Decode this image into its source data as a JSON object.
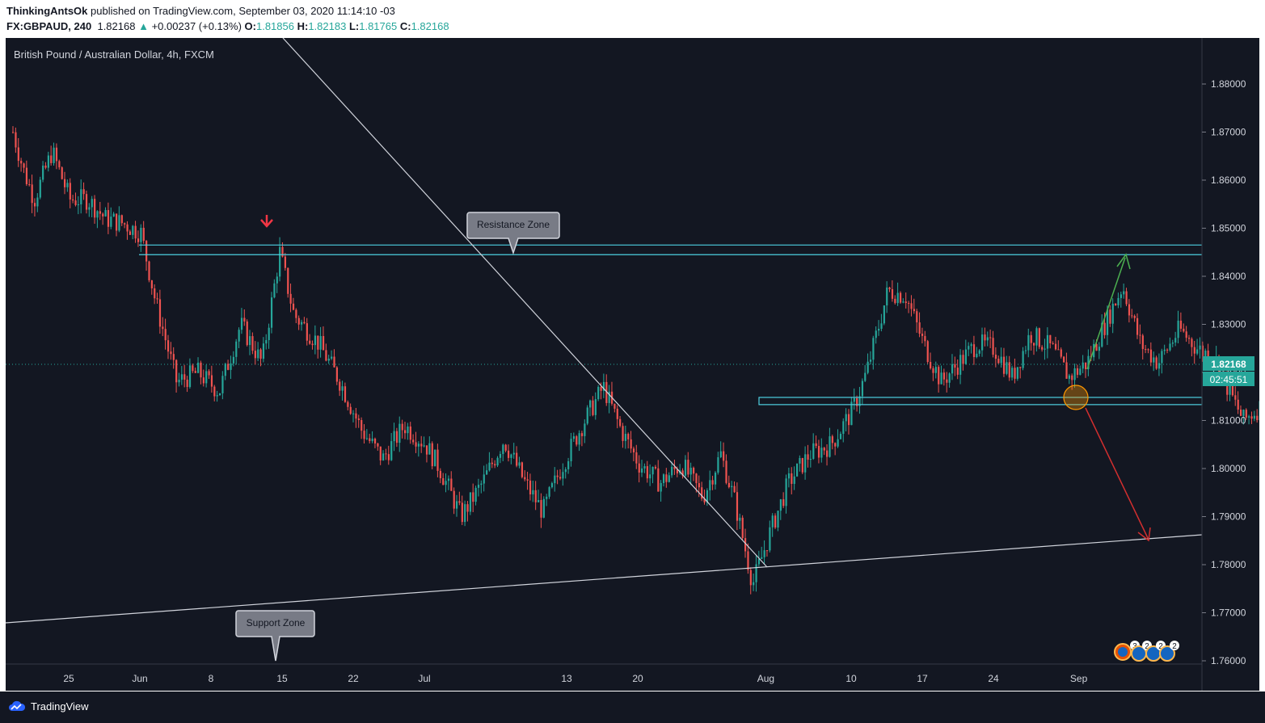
{
  "header": {
    "author": "ThinkingAntsOk",
    "published_text": "published on TradingView.com, September 03, 2020 11:14:10 -03",
    "symbol": "FX:GBPAUD, 240",
    "last": "1.82168",
    "change": "+0.00237 (+0.13%)",
    "open_label": "O:",
    "open": "1.81856",
    "high_label": "H:",
    "high": "1.82183",
    "low_label": "L:",
    "low": "1.81765",
    "close_label": "C:",
    "close": "1.82168"
  },
  "chart_data": {
    "type": "candlestick",
    "title": "British Pound / Australian Dollar, 4h, FXCM",
    "y_ticks": [
      "1.88000",
      "1.87000",
      "1.86000",
      "1.85000",
      "1.84000",
      "1.83000",
      "1.82000",
      "1.81000",
      "1.80000",
      "1.79000",
      "1.78000",
      "1.77000",
      "1.76000"
    ],
    "ylim": [
      1.76,
      1.885
    ],
    "x_ticks": [
      "25",
      "Jun",
      "8",
      "15",
      "22",
      "Jul",
      "13",
      "20",
      "Aug",
      "10",
      "17",
      "24",
      "Sep"
    ],
    "price_path": [
      [
        0,
        1.87
      ],
      [
        0.15,
        1.862
      ],
      [
        0.3,
        1.856
      ],
      [
        0.55,
        1.866
      ],
      [
        0.8,
        1.856
      ],
      [
        1.05,
        1.856
      ],
      [
        1.3,
        1.852
      ],
      [
        1.55,
        1.851
      ],
      [
        1.8,
        1.849
      ],
      [
        2.0,
        1.835
      ],
      [
        2.3,
        1.818
      ],
      [
        2.6,
        1.82
      ],
      [
        2.9,
        1.816
      ],
      [
        3.2,
        1.83
      ],
      [
        3.5,
        1.822
      ],
      [
        3.75,
        1.845
      ],
      [
        3.95,
        1.832
      ],
      [
        4.3,
        1.826
      ],
      [
        4.6,
        1.818
      ],
      [
        4.9,
        1.808
      ],
      [
        5.2,
        1.802
      ],
      [
        5.5,
        1.809
      ],
      [
        5.8,
        1.805
      ],
      [
        6.0,
        1.8
      ],
      [
        6.3,
        1.79
      ],
      [
        6.6,
        1.797
      ],
      [
        6.9,
        1.806
      ],
      [
        7.2,
        1.797
      ],
      [
        7.45,
        1.791
      ],
      [
        7.7,
        1.8
      ],
      [
        8.0,
        1.809
      ],
      [
        8.3,
        1.817
      ],
      [
        8.55,
        1.808
      ],
      [
        8.8,
        1.801
      ],
      [
        9.1,
        1.797
      ],
      [
        9.4,
        1.801
      ],
      [
        9.7,
        1.794
      ],
      [
        9.95,
        1.803
      ],
      [
        10.15,
        1.793
      ],
      [
        10.4,
        1.776
      ],
      [
        10.65,
        1.787
      ],
      [
        10.9,
        1.797
      ],
      [
        11.2,
        1.803
      ],
      [
        11.5,
        1.805
      ],
      [
        11.8,
        1.812
      ],
      [
        12.0,
        1.82
      ],
      [
        12.3,
        1.837
      ],
      [
        12.55,
        1.836
      ],
      [
        12.8,
        1.826
      ],
      [
        13.05,
        1.818
      ],
      [
        13.3,
        1.822
      ],
      [
        13.55,
        1.826
      ],
      [
        13.8,
        1.825
      ],
      [
        14.05,
        1.819
      ],
      [
        14.3,
        1.828
      ],
      [
        14.6,
        1.825
      ],
      [
        14.85,
        1.819
      ],
      [
        15.1,
        1.822
      ],
      [
        15.35,
        1.83
      ],
      [
        15.6,
        1.838
      ],
      [
        15.85,
        1.826
      ],
      [
        16.1,
        1.822
      ],
      [
        16.4,
        1.829
      ],
      [
        16.65,
        1.825
      ],
      [
        16.9,
        1.823
      ],
      [
        17.1,
        1.816
      ],
      [
        17.3,
        1.81
      ],
      [
        17.55,
        1.813
      ],
      [
        17.8,
        1.82
      ],
      [
        17.95,
        1.8217
      ]
    ],
    "annotations": {
      "resistance_label": "Resistance Zone",
      "support_label": "Support Zone",
      "price_tag": "1.82168",
      "countdown": "02:45:51",
      "event_badges": [
        "3",
        "2",
        "2",
        "2"
      ]
    },
    "zones": {
      "resistance": [
        1.8445,
        1.8465
      ],
      "support_box": [
        1.8133,
        1.8148
      ]
    }
  },
  "footer": {
    "brand": "TradingView"
  },
  "colors": {
    "background": "#131722",
    "up": "#26a69a",
    "down": "#ef5350",
    "zone": "#4dd0e1",
    "arrow_up": "#4caf50",
    "arrow_down": "#d32f2f"
  }
}
